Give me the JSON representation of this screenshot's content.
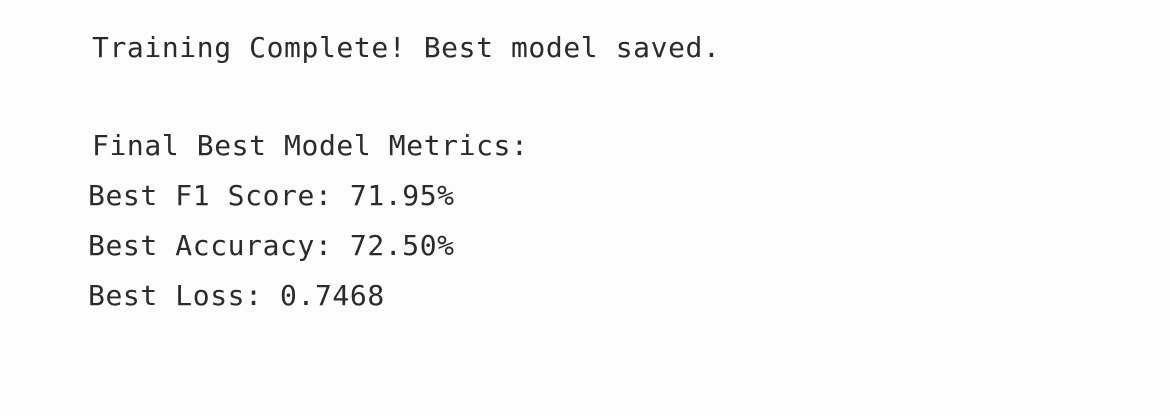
{
  "output": {
    "status_line": "Training Complete! Best model saved.",
    "metrics_header": "Final Best Model Metrics:",
    "metrics": [
      {
        "text": "Best F1 Score: 71.95%"
      },
      {
        "text": "Best Accuracy: 72.50%"
      },
      {
        "text": "Best Loss: 0.7468"
      }
    ]
  }
}
